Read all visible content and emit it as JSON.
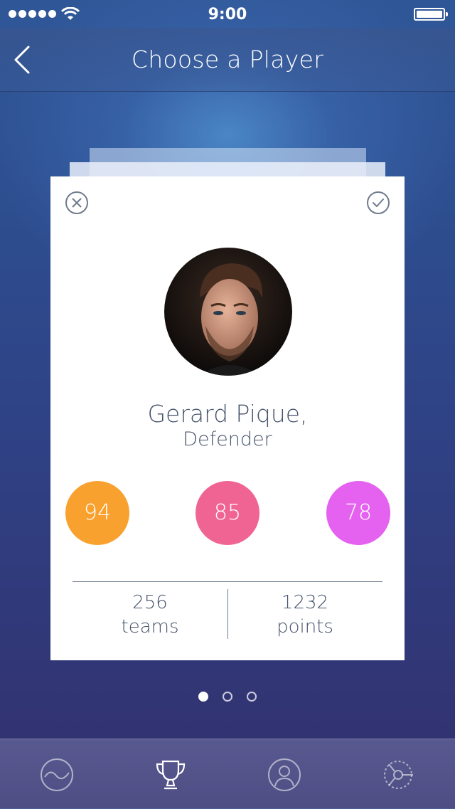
{
  "status_bar": {
    "time": "9:00",
    "icons": [
      "signal-icon",
      "wifi-icon",
      "battery-icon"
    ]
  },
  "navbar": {
    "title": "Choose a Player",
    "back_icon": "chevron-left-icon"
  },
  "card": {
    "dismiss_icon": "close-circle-icon",
    "confirm_icon": "check-circle-icon",
    "player_name": "Gerard Pique,",
    "player_position": "Defender",
    "stats": [
      {
        "value": "94",
        "color": "#F9A12E"
      },
      {
        "value": "85",
        "color": "#F06494"
      },
      {
        "value": "78",
        "color": "#E561EF"
      }
    ],
    "metrics": [
      {
        "value": "256",
        "label": "teams"
      },
      {
        "value": "1232",
        "label": "points"
      }
    ]
  },
  "pager": {
    "count": 3,
    "active": 0
  },
  "tabbar": {
    "tabs": [
      {
        "icon": "activity-wave-icon",
        "active": false
      },
      {
        "icon": "trophy-icon",
        "active": true
      },
      {
        "icon": "profile-icon",
        "active": false
      },
      {
        "icon": "settings-dial-icon",
        "active": false
      }
    ]
  },
  "colors": {
    "card_text": "#45536B",
    "stat_orange": "#F9A12E",
    "stat_pink": "#F06494",
    "stat_magenta": "#E561EF"
  }
}
